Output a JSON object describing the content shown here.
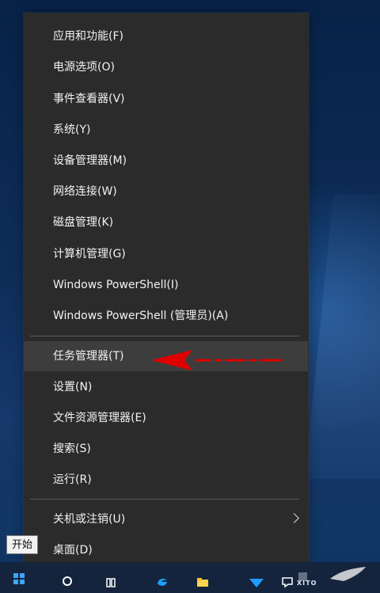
{
  "menu": {
    "items": [
      {
        "label": "应用和功能(F)"
      },
      {
        "label": "电源选项(O)"
      },
      {
        "label": "事件查看器(V)"
      },
      {
        "label": "系统(Y)"
      },
      {
        "label": "设备管理器(M)"
      },
      {
        "label": "网络连接(W)"
      },
      {
        "label": "磁盘管理(K)"
      },
      {
        "label": "计算机管理(G)"
      },
      {
        "label": "Windows PowerShell(I)"
      },
      {
        "label": "Windows PowerShell (管理员)(A)"
      },
      {
        "label": "任务管理器(T)",
        "selected": true
      },
      {
        "label": "设置(N)"
      },
      {
        "label": "文件资源管理器(E)"
      },
      {
        "label": "搜索(S)"
      },
      {
        "label": "运行(R)"
      },
      {
        "label": "关机或注销(U)",
        "submenu": true
      },
      {
        "label": "桌面(D)"
      }
    ]
  },
  "tooltip": {
    "text": "开始"
  },
  "taskbar": {
    "icons": [
      {
        "name": "start-button-icon"
      },
      {
        "name": "search-icon"
      },
      {
        "name": "task-view-icon"
      },
      {
        "name": "edge-icon"
      },
      {
        "name": "file-explorer-icon"
      },
      {
        "name": "blue-app-icon"
      },
      {
        "name": "notification-icon"
      }
    ]
  },
  "annotation": {
    "color": "#e00000",
    "target": "任务管理器(T)"
  },
  "watermark": {
    "text": "XITO"
  },
  "colors": {
    "menu_background": "#2b2b2b",
    "selected_item_background": "#3d3d3d",
    "menu_text": "#f2f2f2",
    "desktop_blue": "#0d2d58",
    "windows_blue": "#3ea5ff"
  }
}
